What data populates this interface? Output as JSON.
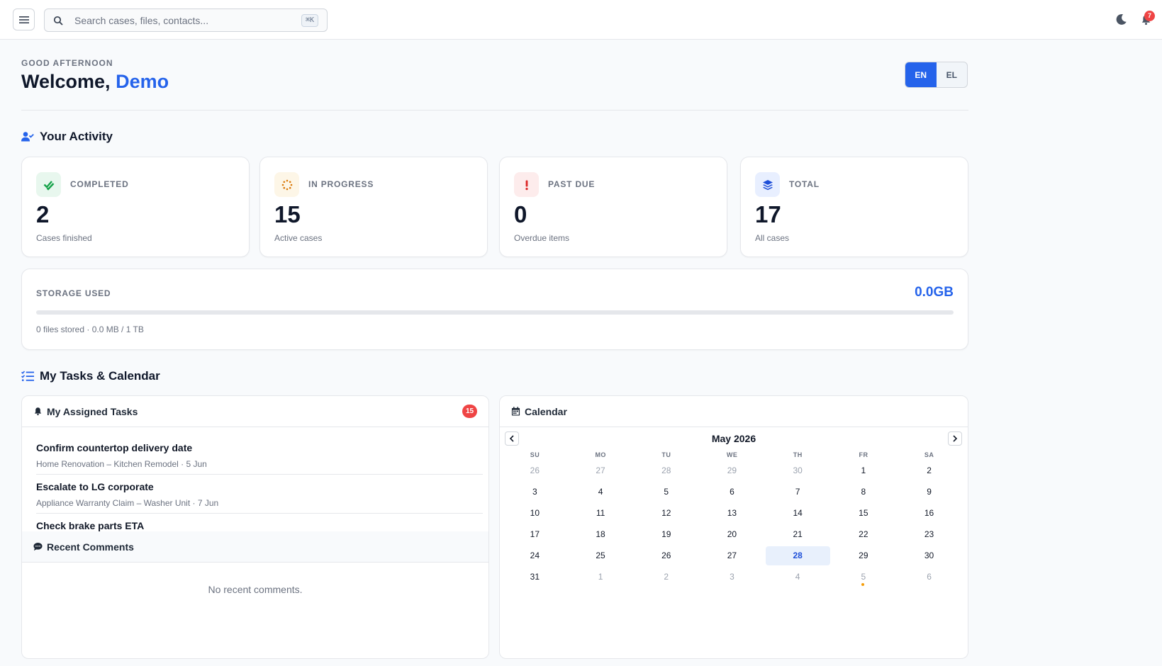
{
  "topbar": {
    "search_placeholder": "Search cases, files, contacts...",
    "search_shortcut": "⌘K",
    "notification_count": "7"
  },
  "greeting": {
    "eyebrow": "GOOD AFTERNOON",
    "welcome": "Welcome,",
    "name": "Demo"
  },
  "language": {
    "options": [
      "EN",
      "EL"
    ],
    "selected": "EN"
  },
  "activity": {
    "title": "Your Activity",
    "cards": [
      {
        "label": "COMPLETED",
        "value": "2",
        "sub": "Cases finished",
        "icon": "double-check-icon",
        "color": "#16a34a",
        "bg": "#e8f7ee"
      },
      {
        "label": "IN PROGRESS",
        "value": "15",
        "sub": "Active cases",
        "icon": "spinner-icon",
        "color": "#d97706",
        "bg": "#fdf6e7"
      },
      {
        "label": "PAST DUE",
        "value": "0",
        "sub": "Overdue items",
        "icon": "exclamation-icon",
        "color": "#dc2626",
        "bg": "#fdecec"
      },
      {
        "label": "TOTAL",
        "value": "17",
        "sub": "All cases",
        "icon": "layers-icon",
        "color": "#1d4ed8",
        "bg": "#e8efff"
      }
    ]
  },
  "storage": {
    "label": "STORAGE USED",
    "value": "0.0GB",
    "sub": "0 files stored · 0.0 MB / 1 TB",
    "used_fraction": 0
  },
  "tasks_calendar": {
    "title": "My Tasks & Calendar"
  },
  "tasks": {
    "title": "My Assigned Tasks",
    "count": "15",
    "items": [
      {
        "title": "Confirm countertop delivery date",
        "meta": "Home Renovation – Kitchen Remodel · 5 Jun"
      },
      {
        "title": "Escalate to LG corporate",
        "meta": "Appliance Warranty Claim – Washer Unit · 7 Jun"
      },
      {
        "title": "Check brake parts ETA",
        "meta": ""
      }
    ]
  },
  "comments": {
    "title": "Recent Comments",
    "empty": "No recent comments."
  },
  "calendar": {
    "title": "Calendar",
    "month": "May 2026",
    "weekdays": [
      "SU",
      "MO",
      "TU",
      "WE",
      "TH",
      "FR",
      "SA"
    ],
    "weeks": [
      [
        {
          "d": "26",
          "m": true
        },
        {
          "d": "27",
          "m": true
        },
        {
          "d": "28",
          "m": true
        },
        {
          "d": "29",
          "m": true
        },
        {
          "d": "30",
          "m": true
        },
        {
          "d": "1"
        },
        {
          "d": "2"
        }
      ],
      [
        {
          "d": "3"
        },
        {
          "d": "4"
        },
        {
          "d": "5"
        },
        {
          "d": "6"
        },
        {
          "d": "7"
        },
        {
          "d": "8"
        },
        {
          "d": "9"
        }
      ],
      [
        {
          "d": "10"
        },
        {
          "d": "11"
        },
        {
          "d": "12"
        },
        {
          "d": "13"
        },
        {
          "d": "14"
        },
        {
          "d": "15"
        },
        {
          "d": "16"
        }
      ],
      [
        {
          "d": "17"
        },
        {
          "d": "18"
        },
        {
          "d": "19"
        },
        {
          "d": "20"
        },
        {
          "d": "21"
        },
        {
          "d": "22"
        },
        {
          "d": "23"
        }
      ],
      [
        {
          "d": "24"
        },
        {
          "d": "25"
        },
        {
          "d": "26"
        },
        {
          "d": "27"
        },
        {
          "d": "28",
          "today": true
        },
        {
          "d": "29"
        },
        {
          "d": "30"
        }
      ],
      [
        {
          "d": "31"
        },
        {
          "d": "1",
          "m": true
        },
        {
          "d": "2",
          "m": true
        },
        {
          "d": "3",
          "m": true
        },
        {
          "d": "4",
          "m": true
        },
        {
          "d": "5",
          "m": true,
          "event": true
        },
        {
          "d": "6",
          "m": true
        }
      ]
    ]
  }
}
